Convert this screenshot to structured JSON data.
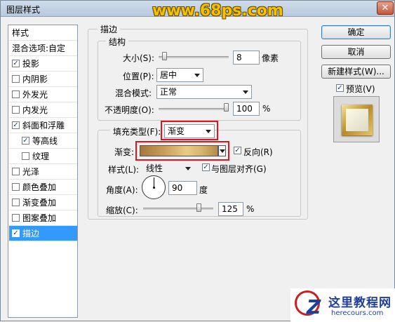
{
  "window": {
    "title": "图层样式",
    "watermark": "www.68ps.com",
    "close_label": "✕"
  },
  "style_list": {
    "header": "样式",
    "blend_options": "混合选项:自定",
    "items": [
      {
        "label": "投影",
        "checked": true
      },
      {
        "label": "内阴影",
        "checked": false
      },
      {
        "label": "外发光",
        "checked": false
      },
      {
        "label": "内发光",
        "checked": false
      },
      {
        "label": "斜面和浮雕",
        "checked": true
      },
      {
        "label": "等高线",
        "checked": true
      },
      {
        "label": "纹理",
        "checked": false
      },
      {
        "label": "光泽",
        "checked": false
      },
      {
        "label": "颜色叠加",
        "checked": false
      },
      {
        "label": "渐变叠加",
        "checked": false
      },
      {
        "label": "图案叠加",
        "checked": false
      },
      {
        "label": "描边",
        "checked": true
      }
    ],
    "check_mark": "✓"
  },
  "stroke": {
    "section_title": "描边",
    "structure_title": "结构",
    "size_label": "大小(S):",
    "size_value": "8",
    "size_unit": "像素",
    "size_slider": 0.05,
    "position_label": "位置(P):",
    "position_value": "居中",
    "blend_label": "混合模式:",
    "blend_value": "正常",
    "opacity_label": "不透明度(O):",
    "opacity_value": "100",
    "opacity_unit": "%",
    "opacity_slider": 1.0,
    "fill_type_label": "填充类型(F):",
    "fill_type_value": "渐变",
    "gradient_label": "渐变:",
    "reverse_label": "反向(R)",
    "reverse_checked": true,
    "style_label": "样式(L):",
    "style_value": "线性",
    "align_label": "与图层对齐(G)",
    "align_checked": true,
    "angle_label": "角度(A):",
    "angle_value": "90",
    "angle_unit": "度",
    "scale_label": "缩放(C):",
    "scale_value": "125",
    "scale_unit": "%",
    "scale_slider": 0.82
  },
  "buttons": {
    "ok": "确定",
    "cancel": "取消",
    "new_style": "新建样式(W)...",
    "preview_label": "预览(V)",
    "preview_checked": true
  },
  "logo": {
    "mark": "Z",
    "text": "这里教程网",
    "sub": "herecours.com"
  }
}
